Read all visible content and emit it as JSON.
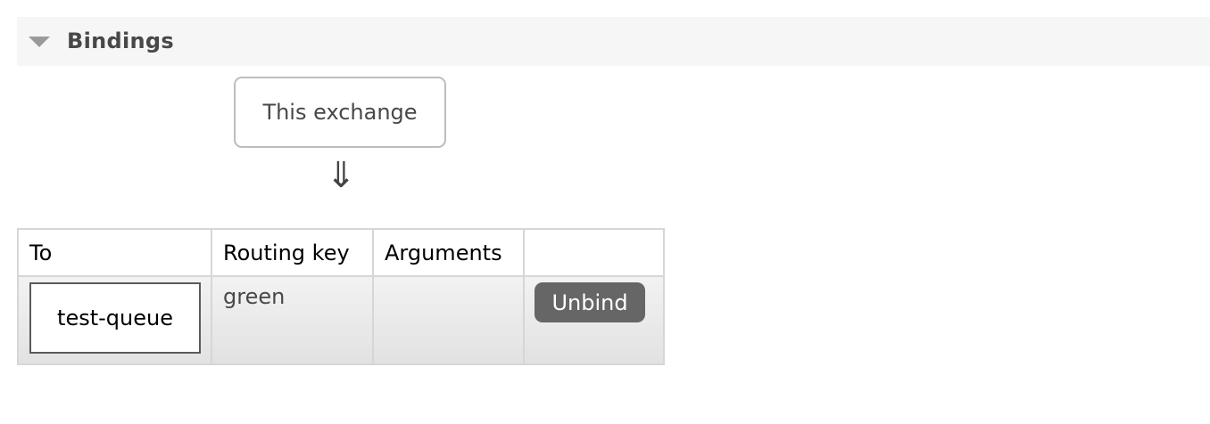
{
  "section": {
    "title": "Bindings",
    "toggle_icon": "triangle-down-icon"
  },
  "diagram": {
    "source_label": "This exchange",
    "arrow": "⇓"
  },
  "table": {
    "headers": [
      "To",
      "Routing key",
      "Arguments",
      ""
    ],
    "rows": [
      {
        "to": "test-queue",
        "routing_key": "green",
        "arguments": "",
        "action": "Unbind"
      }
    ]
  },
  "colors": {
    "header_bg": "#f6f6f6",
    "button_bg": "#666666",
    "border": "#d6d6d6"
  }
}
